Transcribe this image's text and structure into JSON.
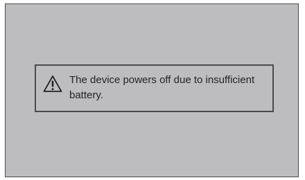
{
  "dialog": {
    "icon": "warning-triangle-icon",
    "message": "The device powers off due to insufficient battery."
  },
  "colors": {
    "screen_background": "#bdbdc0",
    "border": "#4a4a4a",
    "text": "#232323"
  }
}
